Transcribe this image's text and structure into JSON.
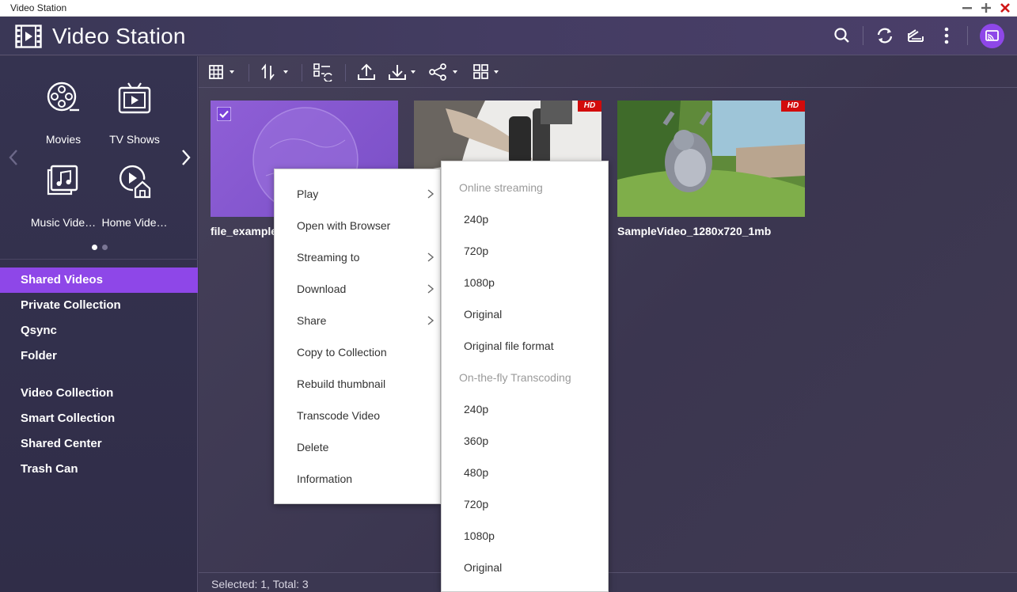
{
  "window": {
    "title": "Video Station"
  },
  "header": {
    "title": "Video Station"
  },
  "sidebar": {
    "categories": [
      {
        "label": "Movies"
      },
      {
        "label": "TV Shows"
      },
      {
        "label": "Music Vide…"
      },
      {
        "label": "Home Vide…"
      }
    ],
    "nav_items": [
      {
        "label": "Shared Videos",
        "active": true
      },
      {
        "label": "Private Collection"
      },
      {
        "label": "Qsync"
      },
      {
        "label": "Folder"
      },
      {
        "label": "Video Collection"
      },
      {
        "label": "Smart Collection"
      },
      {
        "label": "Shared Center"
      },
      {
        "label": "Trash Can"
      }
    ]
  },
  "videos": [
    {
      "name": "file_example_",
      "selected": true,
      "hd": false
    },
    {
      "name": "",
      "selected": false,
      "hd": true,
      "badge": "HD"
    },
    {
      "name": "SampleVideo_1280x720_1mb",
      "selected": false,
      "hd": true,
      "badge": "HD"
    }
  ],
  "context_menu": {
    "items": [
      {
        "label": "Play",
        "submenu": true
      },
      {
        "label": "Open with Browser"
      },
      {
        "label": "Streaming to",
        "submenu": true
      },
      {
        "label": "Download",
        "submenu": true
      },
      {
        "label": "Share",
        "submenu": true
      },
      {
        "label": "Copy to Collection"
      },
      {
        "label": "Rebuild thumbnail"
      },
      {
        "label": "Transcode Video"
      },
      {
        "label": "Delete"
      },
      {
        "label": "Information"
      }
    ]
  },
  "play_submenu": {
    "online_header": "Online streaming",
    "online_items": [
      "240p",
      "720p",
      "1080p",
      "Original",
      "Original file format"
    ],
    "transcode_header": "On-the-fly Transcoding",
    "transcode_items": [
      "240p",
      "360p",
      "480p",
      "720p",
      "1080p",
      "Original"
    ]
  },
  "status": {
    "text": "Selected: 1, Total: 3"
  },
  "colors": {
    "accent": "#8e47e8",
    "hd_badge": "#d20b0b"
  }
}
